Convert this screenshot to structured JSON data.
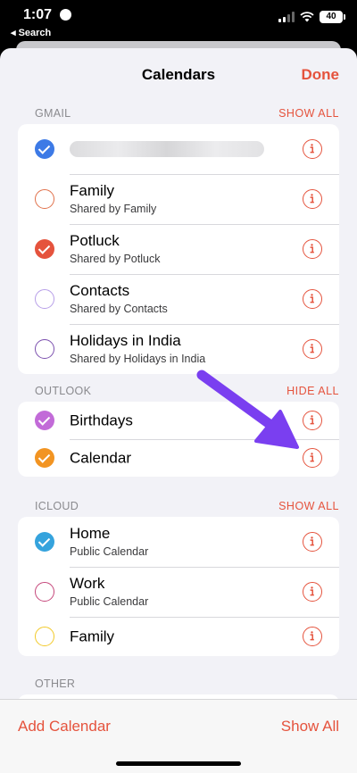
{
  "status_bar": {
    "time": "1:07",
    "back_label": "◂ Search",
    "battery": "40"
  },
  "sheet": {
    "title": "Calendars",
    "done_label": "Done"
  },
  "sections": {
    "gmail": {
      "header": "GMAIL",
      "action": "SHOW ALL",
      "rows": [
        {
          "title": "",
          "subtitle": "",
          "checked": true,
          "color": "#3d7ae6"
        },
        {
          "title": "Family",
          "subtitle": "Shared by Family",
          "checked": false,
          "color": "#e0704a"
        },
        {
          "title": "Potluck",
          "subtitle": "Shared by Potluck",
          "checked": true,
          "color": "#e5533d"
        },
        {
          "title": "Contacts",
          "subtitle": "Shared by Contacts",
          "checked": false,
          "color": "#b79ee8"
        },
        {
          "title": "Holidays in India",
          "subtitle": "Shared by Holidays in India",
          "checked": false,
          "color": "#7b4fae"
        }
      ]
    },
    "outlook": {
      "header": "OUTLOOK",
      "action": "HIDE ALL",
      "rows": [
        {
          "title": "Birthdays",
          "checked": true,
          "color": "#c26bd8"
        },
        {
          "title": "Calendar",
          "checked": true,
          "color": "#f29422"
        }
      ]
    },
    "icloud": {
      "header": "ICLOUD",
      "action": "SHOW ALL",
      "rows": [
        {
          "title": "Home",
          "subtitle": "Public Calendar",
          "checked": true,
          "color": "#35a3dd"
        },
        {
          "title": "Work",
          "subtitle": "Public Calendar",
          "checked": false,
          "color": "#c5467a"
        },
        {
          "title": "Family",
          "subtitle": "",
          "checked": false,
          "color": "#f2c928"
        }
      ]
    },
    "other": {
      "header": "OTHER"
    }
  },
  "toolbar": {
    "add_label": "Add Calendar",
    "show_all_label": "Show All"
  },
  "colors": {
    "accent": "#e5533d",
    "annotation_arrow": "#7a3ff0"
  },
  "icons": {
    "info": "info-circle-icon",
    "checkmark": "checkmark-icon"
  }
}
